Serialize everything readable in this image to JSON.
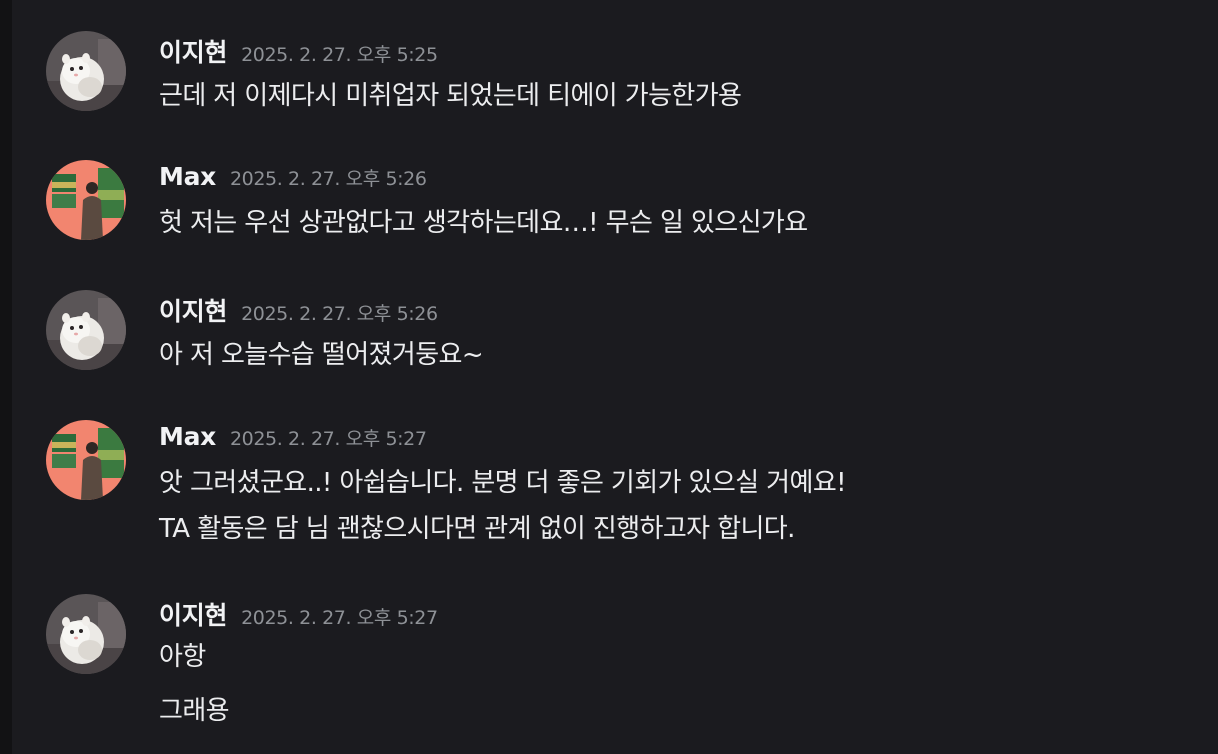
{
  "messages": [
    {
      "author": "이지현",
      "avatar": "hamster-avatar",
      "timestamp": "2025. 2. 27. 오후 5:25",
      "lines": [
        "근데 저 이제다시 미취업자 되었는데 티에이 가능한가용"
      ]
    },
    {
      "author": "Max",
      "avatar": "gallery-avatar",
      "timestamp": "2025. 2. 27. 오후 5:26",
      "lines": [
        "헛 저는 우선 상관없다고 생각하는데요…! 무슨 일 있으신가요"
      ]
    },
    {
      "author": "이지현",
      "avatar": "hamster-avatar",
      "timestamp": "2025. 2. 27. 오후 5:26",
      "lines": [
        "아 저 오늘수습 떨어졌거둥요~"
      ]
    },
    {
      "author": "Max",
      "avatar": "gallery-avatar",
      "timestamp": "2025. 2. 27. 오후 5:27",
      "lines": [
        "앗 그러셨군요..! 아쉽습니다. 분명 더 좋은 기회가 있으실 거예요!",
        "TA 활동은 담 님 괜찮으시다면 관계 없이 진행하고자 합니다."
      ]
    },
    {
      "author": "이지현",
      "avatar": "hamster-avatar",
      "timestamp": "2025. 2. 27. 오후 5:27",
      "lines": [
        "아항",
        "그래용"
      ]
    }
  ],
  "colors": {
    "background": "#1b1b1f",
    "text": "#ecedef",
    "timestamp": "#8e9196",
    "max_avatar_bg": "#f2856f"
  }
}
